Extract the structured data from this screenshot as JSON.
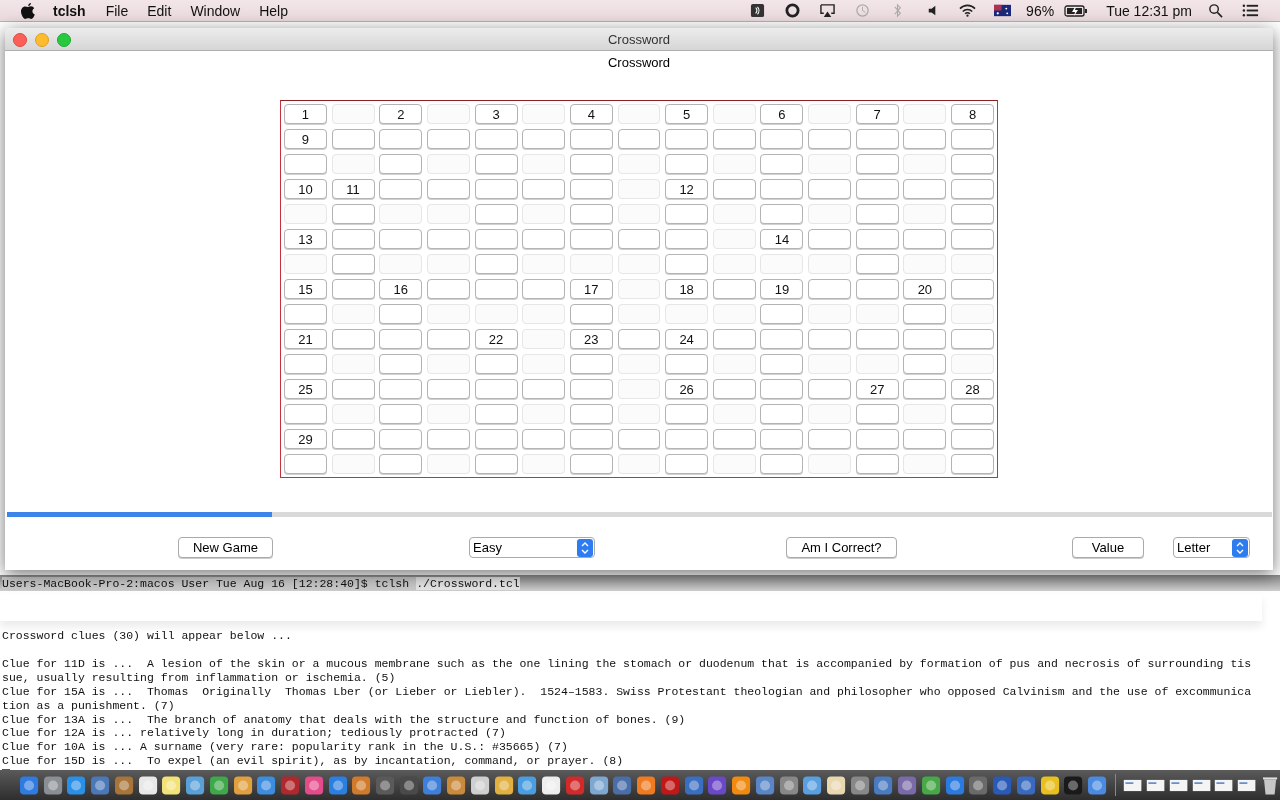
{
  "menu_bar": {
    "app": "tclsh",
    "menus": [
      "File",
      "Edit",
      "Window",
      "Help"
    ],
    "battery": "96%",
    "clock": "Tue 12:31 pm"
  },
  "window": {
    "title": "Crossword",
    "heading": "Crossword",
    "grid": {
      "rows": [
        {
          "cells": [
            {
              "label": "1",
              "open": true
            },
            {
              "open": false
            },
            {
              "label": "2",
              "open": true
            },
            {
              "open": false
            },
            {
              "label": "3",
              "open": true
            },
            {
              "open": false
            },
            {
              "label": "4",
              "open": true
            },
            {
              "open": false
            },
            {
              "label": "5",
              "open": true
            },
            {
              "open": false
            },
            {
              "label": "6",
              "open": true
            },
            {
              "open": false
            },
            {
              "label": "7",
              "open": true
            },
            {
              "open": false
            },
            {
              "label": "8",
              "open": true
            }
          ]
        },
        {
          "cells": [
            {
              "label": "9",
              "open": true
            },
            {
              "open": true
            },
            {
              "open": true
            },
            {
              "open": true
            },
            {
              "open": true
            },
            {
              "open": true
            },
            {
              "open": true
            },
            {
              "open": true
            },
            {
              "open": true
            },
            {
              "open": true
            },
            {
              "open": true
            },
            {
              "open": true
            },
            {
              "open": true
            },
            {
              "open": true
            },
            {
              "open": true
            }
          ]
        },
        {
          "cells": [
            {
              "open": true
            },
            {
              "open": false
            },
            {
              "open": true
            },
            {
              "open": false
            },
            {
              "open": true
            },
            {
              "open": false
            },
            {
              "open": true
            },
            {
              "open": false
            },
            {
              "open": true
            },
            {
              "open": false
            },
            {
              "open": true
            },
            {
              "open": false
            },
            {
              "open": true
            },
            {
              "open": false
            },
            {
              "open": true
            }
          ]
        },
        {
          "cells": [
            {
              "label": "10",
              "open": true
            },
            {
              "label": "11",
              "open": true
            },
            {
              "open": true
            },
            {
              "open": true
            },
            {
              "open": true
            },
            {
              "open": true
            },
            {
              "open": true
            },
            {
              "open": false
            },
            {
              "label": "12",
              "open": true
            },
            {
              "open": true
            },
            {
              "open": true
            },
            {
              "open": true
            },
            {
              "open": true
            },
            {
              "open": true
            },
            {
              "open": true
            }
          ]
        },
        {
          "cells": [
            {
              "open": false
            },
            {
              "open": true
            },
            {
              "open": false
            },
            {
              "open": false
            },
            {
              "open": true
            },
            {
              "open": false
            },
            {
              "open": true
            },
            {
              "open": false
            },
            {
              "open": true
            },
            {
              "open": false
            },
            {
              "open": true
            },
            {
              "open": false
            },
            {
              "open": true
            },
            {
              "open": false
            },
            {
              "open": true
            }
          ]
        },
        {
          "cells": [
            {
              "label": "13",
              "open": true
            },
            {
              "open": true
            },
            {
              "open": true
            },
            {
              "open": true
            },
            {
              "open": true
            },
            {
              "open": true
            },
            {
              "open": true
            },
            {
              "open": true
            },
            {
              "open": true
            },
            {
              "open": false
            },
            {
              "label": "14",
              "open": true
            },
            {
              "open": true
            },
            {
              "open": true
            },
            {
              "open": true
            },
            {
              "open": true
            }
          ]
        },
        {
          "cells": [
            {
              "open": false
            },
            {
              "open": true
            },
            {
              "open": false
            },
            {
              "open": false
            },
            {
              "open": true
            },
            {
              "open": false
            },
            {
              "open": false
            },
            {
              "open": false
            },
            {
              "open": true
            },
            {
              "open": false
            },
            {
              "open": false
            },
            {
              "open": false
            },
            {
              "open": true
            },
            {
              "open": false
            },
            {
              "open": false
            }
          ]
        },
        {
          "cells": [
            {
              "label": "15",
              "open": true
            },
            {
              "open": true
            },
            {
              "label": "16",
              "open": true
            },
            {
              "open": true
            },
            {
              "open": true
            },
            {
              "open": true
            },
            {
              "label": "17",
              "open": true
            },
            {
              "open": false
            },
            {
              "label": "18",
              "open": true
            },
            {
              "open": true
            },
            {
              "label": "19",
              "open": true
            },
            {
              "open": true
            },
            {
              "open": true
            },
            {
              "label": "20",
              "open": true
            },
            {
              "open": true
            }
          ]
        },
        {
          "cells": [
            {
              "open": true
            },
            {
              "open": false
            },
            {
              "open": true
            },
            {
              "open": false
            },
            {
              "open": false
            },
            {
              "open": false
            },
            {
              "open": true
            },
            {
              "open": false
            },
            {
              "open": false
            },
            {
              "open": false
            },
            {
              "open": true
            },
            {
              "open": false
            },
            {
              "open": false
            },
            {
              "open": true
            },
            {
              "open": false
            }
          ]
        },
        {
          "cells": [
            {
              "label": "21",
              "open": true
            },
            {
              "open": true
            },
            {
              "open": true
            },
            {
              "open": true
            },
            {
              "label": "22",
              "open": true
            },
            {
              "open": false
            },
            {
              "label": "23",
              "open": true
            },
            {
              "open": true
            },
            {
              "label": "24",
              "open": true
            },
            {
              "open": true
            },
            {
              "open": true
            },
            {
              "open": true
            },
            {
              "open": true
            },
            {
              "open": true
            },
            {
              "open": true
            }
          ]
        },
        {
          "cells": [
            {
              "open": true
            },
            {
              "open": false
            },
            {
              "open": true
            },
            {
              "open": false
            },
            {
              "open": true
            },
            {
              "open": false
            },
            {
              "open": true
            },
            {
              "open": false
            },
            {
              "open": true
            },
            {
              "open": false
            },
            {
              "open": true
            },
            {
              "open": false
            },
            {
              "open": false
            },
            {
              "open": true
            },
            {
              "open": false
            }
          ]
        },
        {
          "cells": [
            {
              "label": "25",
              "open": true
            },
            {
              "open": true
            },
            {
              "open": true
            },
            {
              "open": true
            },
            {
              "open": true
            },
            {
              "open": true
            },
            {
              "open": true
            },
            {
              "open": false
            },
            {
              "label": "26",
              "open": true
            },
            {
              "open": true
            },
            {
              "open": true
            },
            {
              "open": true
            },
            {
              "label": "27",
              "open": true
            },
            {
              "open": true
            },
            {
              "label": "28",
              "open": true
            }
          ]
        },
        {
          "cells": [
            {
              "open": true
            },
            {
              "open": false
            },
            {
              "open": true
            },
            {
              "open": false
            },
            {
              "open": true
            },
            {
              "open": false
            },
            {
              "open": true
            },
            {
              "open": false
            },
            {
              "open": true
            },
            {
              "open": false
            },
            {
              "open": true
            },
            {
              "open": false
            },
            {
              "open": true
            },
            {
              "open": false
            },
            {
              "open": true
            }
          ]
        },
        {
          "cells": [
            {
              "label": "29",
              "open": true
            },
            {
              "open": true
            },
            {
              "open": true
            },
            {
              "open": true
            },
            {
              "open": true
            },
            {
              "open": true
            },
            {
              "open": true
            },
            {
              "open": true
            },
            {
              "open": true
            },
            {
              "open": true
            },
            {
              "open": true
            },
            {
              "open": true
            },
            {
              "open": true
            },
            {
              "open": true
            },
            {
              "open": true
            }
          ]
        },
        {
          "cells": [
            {
              "open": true
            },
            {
              "open": false
            },
            {
              "open": true
            },
            {
              "open": false
            },
            {
              "open": true
            },
            {
              "open": false
            },
            {
              "open": true
            },
            {
              "open": false
            },
            {
              "open": true
            },
            {
              "open": false
            },
            {
              "open": true
            },
            {
              "open": false
            },
            {
              "open": true
            },
            {
              "open": false
            },
            {
              "open": true
            }
          ]
        }
      ]
    },
    "progress": {
      "level": 0.21
    },
    "controls": [
      {
        "kind": "button",
        "label": "New Game"
      },
      {
        "kind": "select",
        "value": "Easy"
      },
      {
        "kind": "button",
        "label": "Am I Correct?"
      },
      {
        "kind": "button",
        "label": "Value"
      },
      {
        "kind": "select",
        "value": "Letter"
      }
    ]
  },
  "terminal": {
    "prompt": "Users-MacBook-Pro-2:macos User Tue Aug 16 [12:28:40]$ tclsh",
    "command": "./Crossword.tcl",
    "intro": "Crossword clues (30) will appear below ...",
    "lines": [
      "Clue for 11D is ...  A lesion of the skin or a mucous membrane such as the one lining the stomach or duodenum that is accompanied by formation of pus and necrosis of surrounding tis",
      "sue, usually resulting from inflammation or ischemia. (5)",
      "Clue for 15A is ...  Thomas  Originally  Thomas Lber (or Lieber or Liebler).  1524–1583. Swiss Protestant theologian and philosopher who opposed Calvinism and the use of excommunica",
      "tion as a punishment. (7)",
      "Clue for 13A is ...  The branch of anatomy that deals with the structure and function of bones. (9)",
      "Clue for 12A is ... relatively long in duration; tediously protracted (7)",
      "Clue for 10A is ... A surname (very rare: popularity rank in the U.S.: #35665) (7)",
      "Clue for 15D is ...  To expel (an evil spirit), as by incantation, command, or prayer. (8)"
    ]
  }
}
